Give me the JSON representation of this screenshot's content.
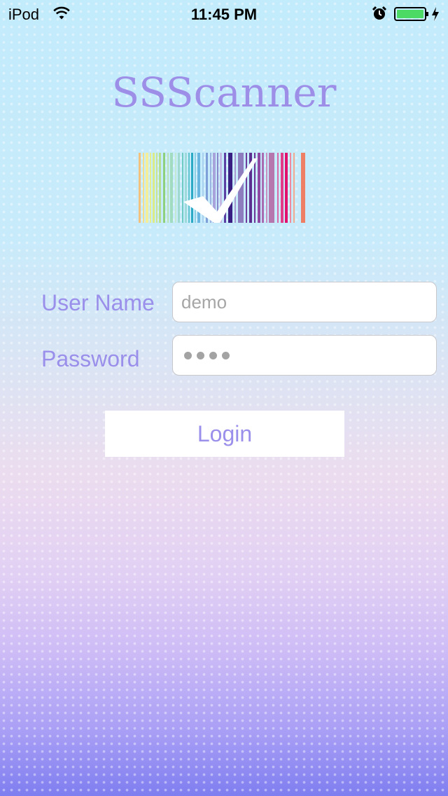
{
  "status_bar": {
    "carrier": "iPod",
    "time": "11:45 PM",
    "battery_color": "#4cd964"
  },
  "app": {
    "title": "SSScanner",
    "logo_icon": "barcode-checkmark-icon"
  },
  "form": {
    "username_label": "User Name",
    "username_placeholder": "demo",
    "username_value": "",
    "password_label": "Password",
    "password_value": "••••"
  },
  "login_button_label": "Login",
  "colors": {
    "accent": "#9a8fea",
    "background_top": "#c2ebfb",
    "background_bottom": "#7f7ef0"
  }
}
